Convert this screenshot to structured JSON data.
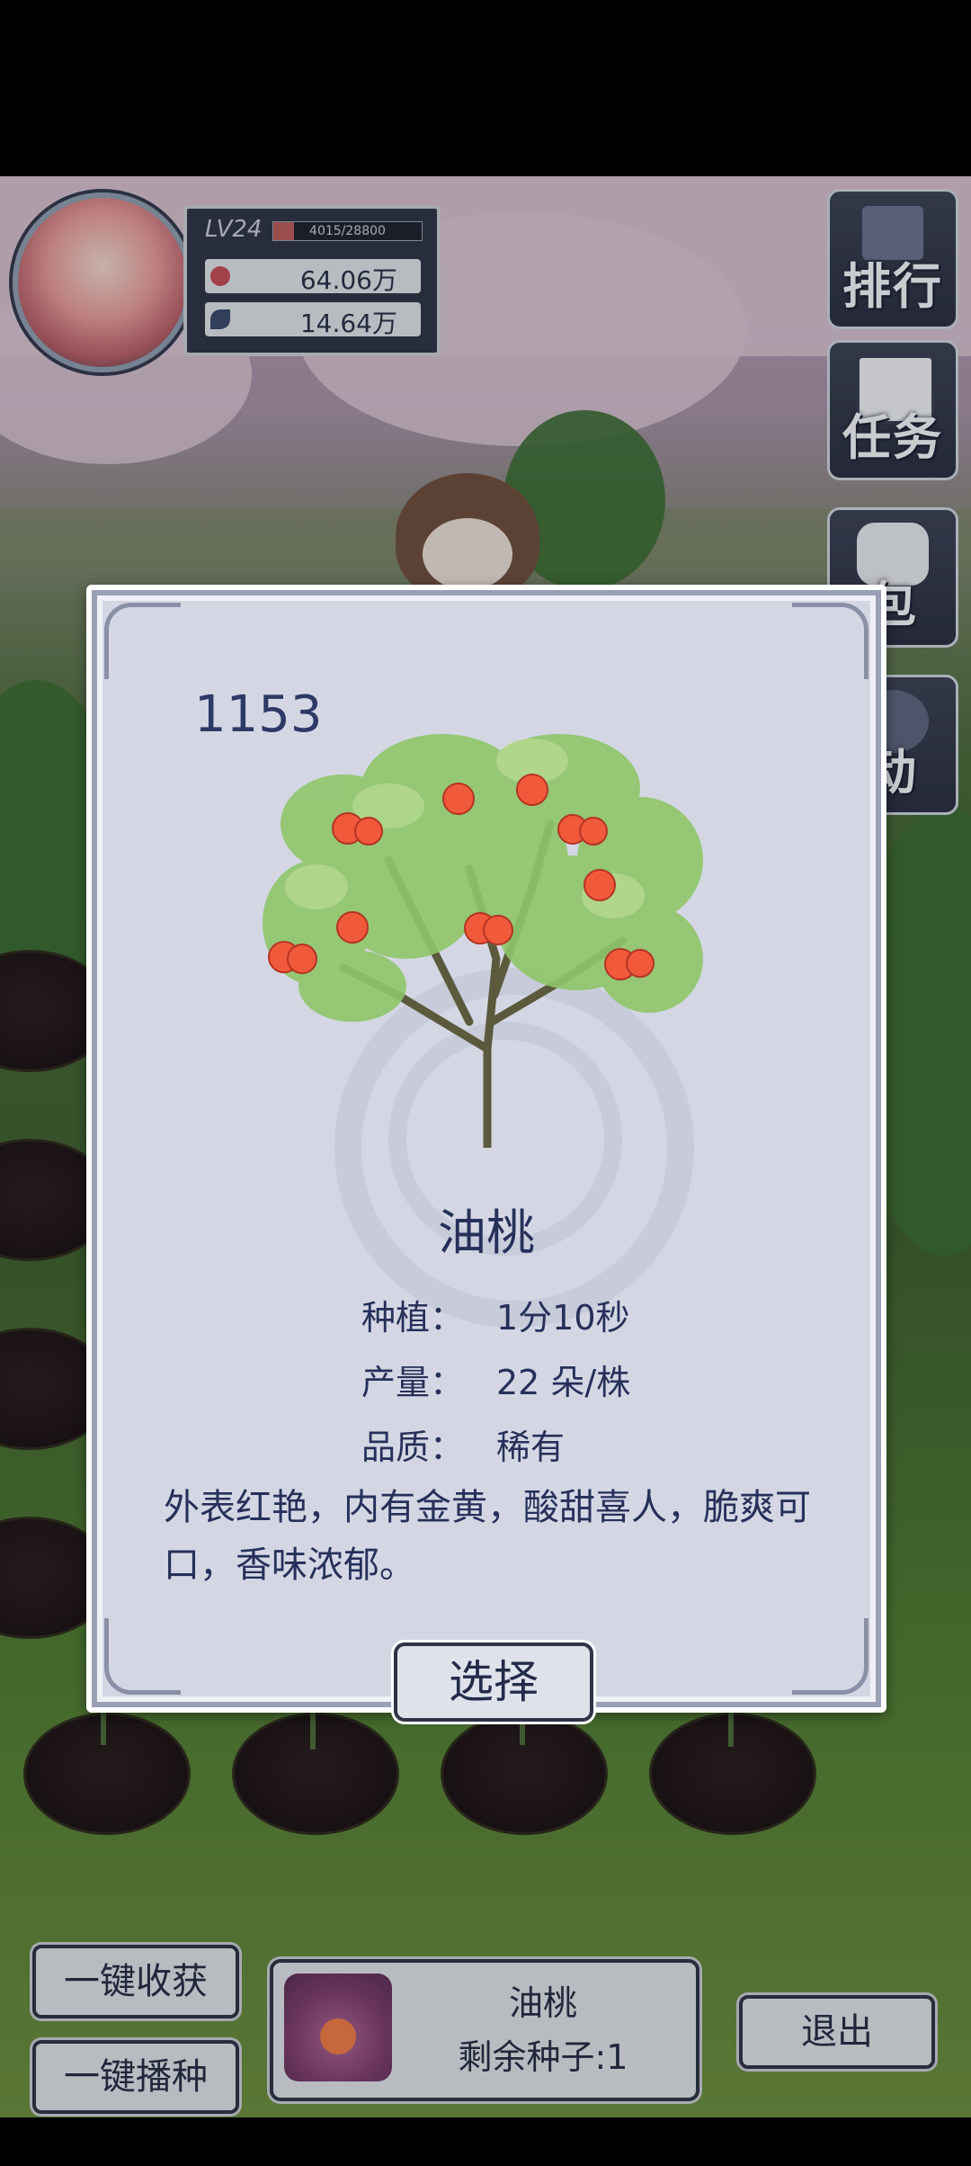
{
  "profile": {
    "level": "LV24",
    "exp_text": "4015/28800",
    "exp_progress": 0.139,
    "coins": "64.06万",
    "leaves": "14.64万"
  },
  "side_menu": [
    {
      "label": "排行",
      "icon": "ranking-icon"
    },
    {
      "label": "任务",
      "icon": "task-scroll-icon"
    },
    {
      "label": "包",
      "icon": "bag-icon"
    },
    {
      "label": "动",
      "icon": "activity-icon"
    }
  ],
  "modal": {
    "id": "1153",
    "name": "油桃",
    "stats": [
      {
        "key": "种植：",
        "value": "1分10秒"
      },
      {
        "key": "产量：",
        "value": "22 朵/株"
      },
      {
        "key": "品质：",
        "value": "稀有"
      }
    ],
    "description": "外表红艳，内有金黄，酸甜喜人，脆爽可口，香味浓郁。",
    "select_label": "选择"
  },
  "bottom": {
    "harvest_all": "一键收获",
    "sow_all": "一键播种",
    "seed_name": "油桃",
    "seeds_left": "剩余种子:1",
    "exit": "退出"
  },
  "colors": {
    "panel_bg": "#d4d7e3",
    "text_navy": "#26305a",
    "frame_dark": "#2f3447",
    "fruit": "#f05a3a"
  }
}
